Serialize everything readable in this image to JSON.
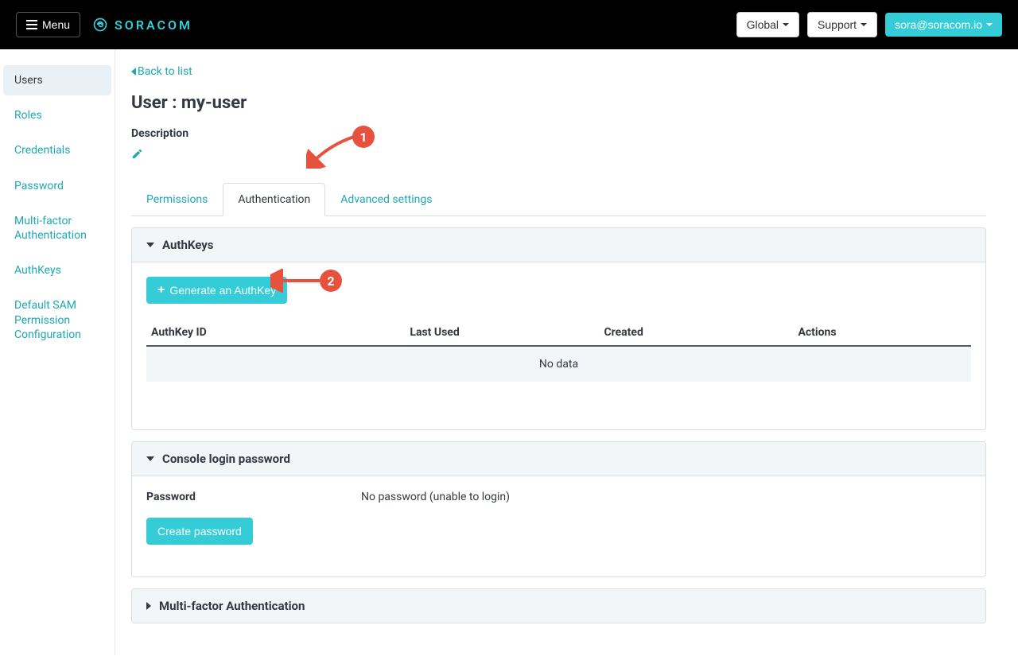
{
  "topbar": {
    "menu_label": "Menu",
    "brand": "SORACOM",
    "global_label": "Global",
    "support_label": "Support",
    "account_label": "sora@soracom.io"
  },
  "sidebar": {
    "items": [
      {
        "label": "Users",
        "active": true
      },
      {
        "label": "Roles"
      },
      {
        "label": "Credentials"
      },
      {
        "label": "Password"
      },
      {
        "label": "Multi-factor Authentication"
      },
      {
        "label": "AuthKeys"
      },
      {
        "label": "Default SAM Permission Configuration"
      }
    ]
  },
  "main": {
    "back_label": "Back to list",
    "title": "User : my-user",
    "description_label": "Description",
    "tabs": [
      {
        "label": "Permissions"
      },
      {
        "label": "Authentication",
        "active": true
      },
      {
        "label": "Advanced settings"
      }
    ]
  },
  "authkeys": {
    "header": "AuthKeys",
    "generate_label": "Generate an AuthKey",
    "columns": {
      "id": "AuthKey ID",
      "last_used": "Last Used",
      "created": "Created",
      "actions": "Actions"
    },
    "empty": "No data"
  },
  "password_panel": {
    "header": "Console login password",
    "label": "Password",
    "value": "No password (unable to login)",
    "create_label": "Create password"
  },
  "mfa_panel": {
    "header": "Multi-factor Authentication"
  },
  "annotations": {
    "one": "1",
    "two": "2"
  }
}
